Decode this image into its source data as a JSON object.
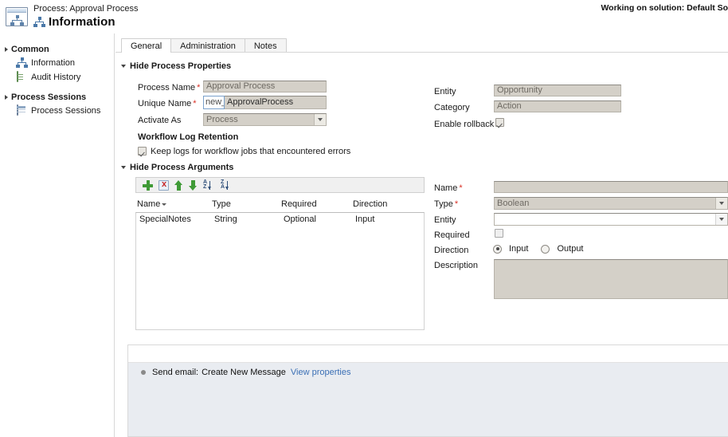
{
  "header": {
    "process_label": "Process: Approval Process",
    "page_title": "Information",
    "solution_note": "Working on solution: Default Sol",
    "window_icon": "process-window-icon",
    "title_icon": "process-node-icon"
  },
  "sidebar": {
    "groups": [
      {
        "label": "Common",
        "items": [
          {
            "label": "Information",
            "icon": "process-node-icon"
          },
          {
            "label": "Audit History",
            "icon": "document-icon"
          }
        ]
      },
      {
        "label": "Process Sessions",
        "items": [
          {
            "label": "Process Sessions",
            "icon": "grid-icon"
          }
        ]
      }
    ]
  },
  "tabs": [
    {
      "label": "General",
      "active": true
    },
    {
      "label": "Administration",
      "active": false
    },
    {
      "label": "Notes",
      "active": false
    }
  ],
  "process_properties": {
    "section_label": "Hide Process Properties",
    "process_name": {
      "label": "Process Name",
      "required": true,
      "value": "Approval Process"
    },
    "unique_name": {
      "label": "Unique Name",
      "required": true,
      "prefix": "new_",
      "value": "ApprovalProcess"
    },
    "activate_as": {
      "label": "Activate As",
      "required": false,
      "value": "Process"
    },
    "entity": {
      "label": "Entity",
      "required": false,
      "value": "Opportunity"
    },
    "category": {
      "label": "Category",
      "required": false,
      "value": "Action"
    },
    "enable_rollback": {
      "label": "Enable rollback",
      "checked": true
    },
    "log_retention": {
      "heading": "Workflow Log Retention",
      "checkbox_label": "Keep logs for workflow jobs that encountered errors",
      "checked": true
    }
  },
  "process_arguments": {
    "section_label": "Hide Process Arguments",
    "toolbar": [
      {
        "name": "add-argument-button",
        "icon": "plus-icon"
      },
      {
        "name": "delete-argument-button",
        "icon": "delete-icon"
      },
      {
        "name": "move-up-button",
        "icon": "arrow-up-icon"
      },
      {
        "name": "move-down-button",
        "icon": "arrow-down-icon"
      },
      {
        "name": "sort-ascending-button",
        "icon": "sort-az-icon"
      },
      {
        "name": "sort-descending-button",
        "icon": "sort-za-icon"
      }
    ],
    "columns": [
      "Name",
      "Type",
      "Required",
      "Direction"
    ],
    "rows": [
      {
        "name": "SpecialNotes",
        "type": "String",
        "required": "Optional",
        "direction": "Input"
      }
    ],
    "detail": {
      "name": {
        "label": "Name",
        "required": true,
        "value": ""
      },
      "type": {
        "label": "Type",
        "required": true,
        "value": "Boolean"
      },
      "entity": {
        "label": "Entity",
        "required": false,
        "value": ""
      },
      "required": {
        "label": "Required",
        "checked": false
      },
      "direction": {
        "label": "Direction",
        "options": [
          {
            "label": "Input",
            "selected": true
          },
          {
            "label": "Output",
            "selected": false
          }
        ]
      },
      "description": {
        "label": "Description",
        "value": ""
      }
    }
  },
  "steps": {
    "rows": [
      {
        "prefix": "Send email:",
        "text": "Create New Message",
        "link": "View properties"
      }
    ]
  }
}
